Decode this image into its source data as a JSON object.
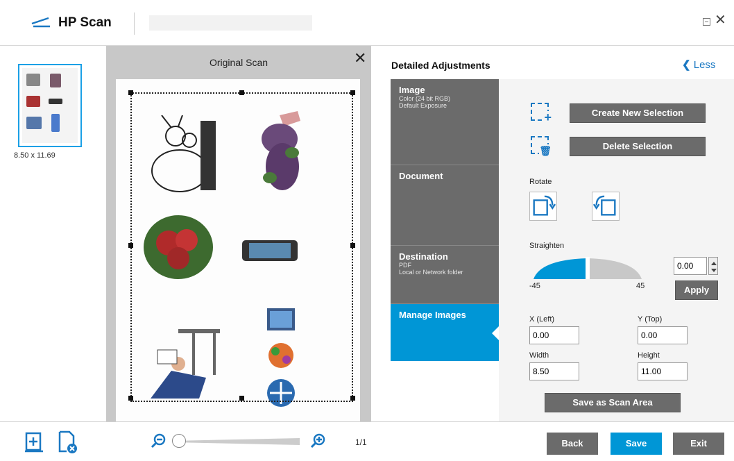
{
  "app": {
    "title": "HP Scan"
  },
  "thumbnails": [
    {
      "size_label": "8.50 x 11.69"
    }
  ],
  "preview": {
    "title": "Original Scan"
  },
  "adjustments": {
    "title": "Detailed Adjustments",
    "less_label": "Less",
    "sections": [
      {
        "title": "Image",
        "subtitle": [
          "Color (24 bit RGB)",
          "Default Exposure"
        ]
      },
      {
        "title": "Document",
        "subtitle": []
      },
      {
        "title": "Destination",
        "subtitle": [
          "PDF",
          "Local or Network folder"
        ]
      },
      {
        "title": "Manage Images",
        "subtitle": [],
        "active": true
      }
    ],
    "create_selection_label": "Create New Selection",
    "delete_selection_label": "Delete Selection",
    "rotate_label": "Rotate",
    "straighten": {
      "label": "Straighten",
      "value": "0.00",
      "min_label": "-45",
      "max_label": "45",
      "apply_label": "Apply",
      "level": 0.5
    },
    "fields": {
      "x_left": {
        "label": "X (Left)",
        "value": "0.00"
      },
      "y_top": {
        "label": "Y (Top)",
        "value": "0.00"
      },
      "width": {
        "label": "Width",
        "value": "8.50"
      },
      "height": {
        "label": "Height",
        "value": "11.00"
      }
    },
    "save_scan_area_label": "Save as Scan Area"
  },
  "bottom": {
    "page_count": "1/1",
    "back_label": "Back",
    "save_label": "Save",
    "exit_label": "Exit",
    "zoom_level": 0
  },
  "colors": {
    "accent": "#0096d6",
    "link": "#1a78c2",
    "dark_gray": "#6b6b6b"
  },
  "icons": [
    "hp-scan-logo-icon",
    "minimize-icon",
    "close-icon",
    "create-selection-icon",
    "delete-selection-icon",
    "rotate-left-icon",
    "rotate-right-icon",
    "add-page-icon",
    "delete-page-icon",
    "zoom-out-icon",
    "zoom-in-icon",
    "chevron-left-icon"
  ]
}
